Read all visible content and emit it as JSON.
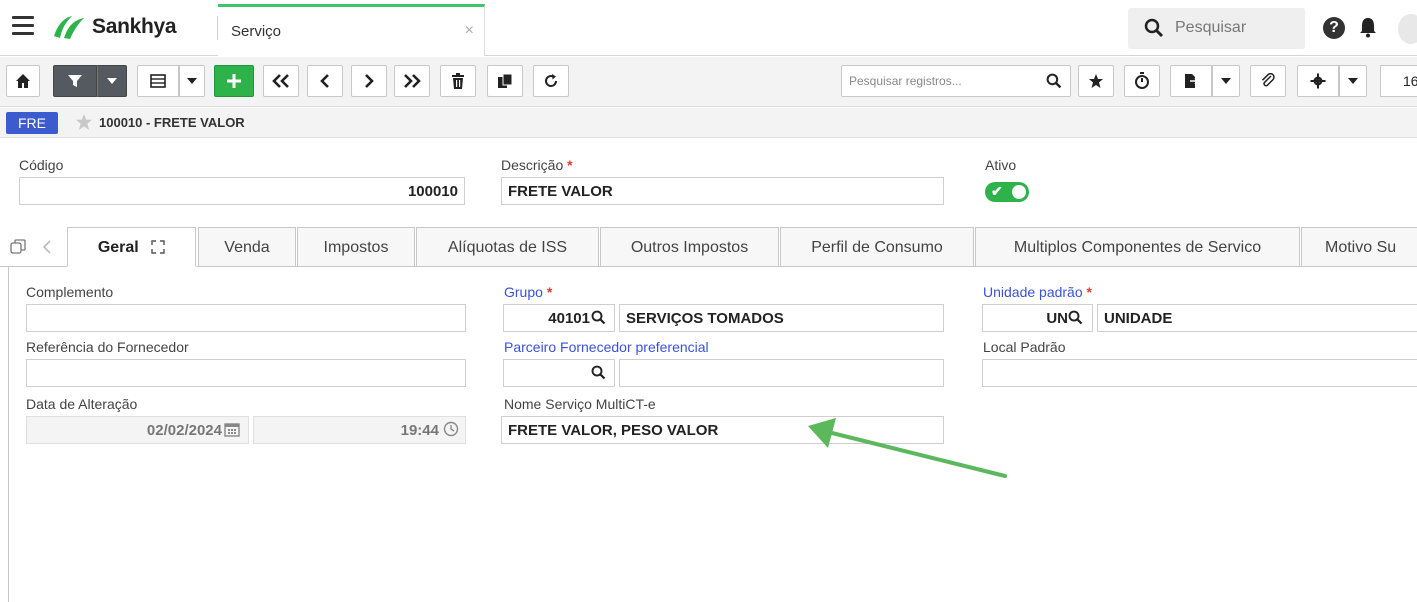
{
  "header": {
    "brand": "Sankhya",
    "tab_label": "Serviço",
    "tab_close": "×",
    "search_placeholder": "Pesquisar",
    "help_glyph": "?"
  },
  "toolbar": {
    "search_placeholder": "Pesquisar registros...",
    "page_size": "16"
  },
  "record": {
    "badge": "FRE",
    "title": "100010 - FRETE VALOR"
  },
  "form": {
    "codigo_label": "Código",
    "codigo_value": "100010",
    "descricao_label": "Descrição",
    "descricao_value": "FRETE VALOR",
    "ativo_label": "Ativo",
    "ativo_value": true,
    "required_mark": "*"
  },
  "tabs": [
    {
      "label": "Geral",
      "active": true
    },
    {
      "label": "Venda"
    },
    {
      "label": "Impostos"
    },
    {
      "label": "Alíquotas de ISS"
    },
    {
      "label": "Outros Impostos"
    },
    {
      "label": "Perfil de Consumo"
    },
    {
      "label": "Multiplos Componentes de Servico"
    },
    {
      "label": "Motivo Su"
    }
  ],
  "geral": {
    "complemento_label": "Complemento",
    "complemento_value": "",
    "referencia_label": "Referência do Fornecedor",
    "referencia_value": "",
    "data_label": "Data de Alteração",
    "data_value": "02/02/2024",
    "hora_value": "19:44",
    "grupo_label": "Grupo",
    "grupo_code": "40101",
    "grupo_desc": "SERVIÇOS TOMADOS",
    "parceiro_label": "Parceiro Fornecedor preferencial",
    "parceiro_code": "",
    "parceiro_desc": "",
    "nome_multicte_label": "Nome Serviço MultiCT-e",
    "nome_multicte_value": "FRETE VALOR, PESO VALOR",
    "unidade_label": "Unidade padrão",
    "unidade_code": "UN",
    "unidade_desc": "UNIDADE",
    "local_label": "Local Padrão",
    "local_value": ""
  },
  "colors": {
    "accent_green": "#2db34a",
    "brand_blue": "#3c5bcf",
    "link_blue": "#3b52d9",
    "required_red": "#e53935",
    "annotation_arrow": "#5cb85c"
  }
}
